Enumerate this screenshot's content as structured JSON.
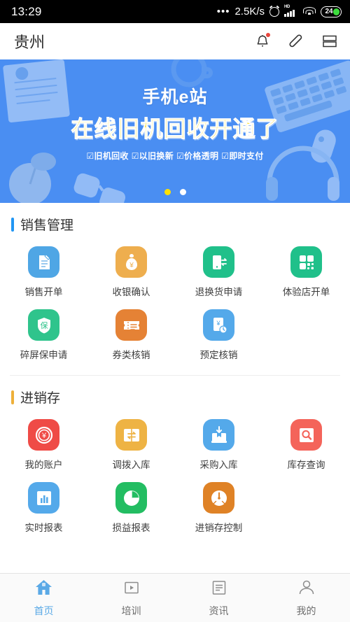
{
  "status_bar": {
    "time": "13:29",
    "dots_icon": "more-dots-icon",
    "net_speed": "2.5K/s",
    "alarm_icon": "alarm-clock-icon",
    "signal_label": "HD",
    "signal_icon": "cellular-signal-icon",
    "wifi_icon": "wifi-icon",
    "battery_level": "24"
  },
  "header": {
    "title": "贵州",
    "notification_icon": "bell-icon",
    "has_notification_badge": true,
    "phone_icon": "phone-handset-icon",
    "layout_icon": "stacked-panels-icon"
  },
  "banner": {
    "brand": "手机e站",
    "headline": "在线旧机回收开通了",
    "features": [
      "旧机回收",
      "以旧换新",
      "价格透明",
      "即时支付"
    ],
    "checkbox_glyph": "☑",
    "bg_color": "#4a8ef2",
    "headline_color": "#ffe033",
    "pages": 2,
    "active_page": 1,
    "active_dot_color": "#ffe100"
  },
  "sections": [
    {
      "title": "销售管理",
      "accent_color": "#2196f3",
      "items": [
        {
          "label": "销售开单",
          "icon": "document-edit-icon",
          "color": "#4fa6e5"
        },
        {
          "label": "收银确认",
          "icon": "money-bag-icon",
          "color": "#eeae4e"
        },
        {
          "label": "退换货申请",
          "icon": "phone-exchange-icon",
          "color": "#20c08a"
        },
        {
          "label": "体验店开单",
          "icon": "qr-code-icon",
          "color": "#20c08a"
        },
        {
          "label": "碎屏保申请",
          "icon": "shield-insurance-icon",
          "color": "#2fc48c"
        },
        {
          "label": "券类核销",
          "icon": "coupon-ticket-icon",
          "color": "#e58235"
        },
        {
          "label": "预定核销",
          "icon": "yuan-card-clock-icon",
          "color": "#54a9ea"
        }
      ]
    },
    {
      "title": "进销存",
      "accent_color": "#eeb03a",
      "items": [
        {
          "label": "我的账户",
          "icon": "yuan-coin-icon",
          "color": "#ef4b46"
        },
        {
          "label": "调拨入库",
          "icon": "transfer-book-icon",
          "color": "#eeb344"
        },
        {
          "label": "采购入库",
          "icon": "box-inbound-icon",
          "color": "#54a9ea"
        },
        {
          "label": "库存查询",
          "icon": "search-box-icon",
          "color": "#f4645a"
        },
        {
          "label": "实时报表",
          "icon": "bar-chart-icon",
          "color": "#54a9ea"
        },
        {
          "label": "损益报表",
          "icon": "pie-chart-icon",
          "color": "#23bd62"
        },
        {
          "label": "进销存控制",
          "icon": "gauge-dial-icon",
          "color": "#df8226"
        }
      ]
    }
  ],
  "tabbar": {
    "active_color": "#5aa9e6",
    "items": [
      {
        "label": "首页",
        "icon": "home-icon",
        "active": true
      },
      {
        "label": "培训",
        "icon": "play-box-icon",
        "active": false
      },
      {
        "label": "资讯",
        "icon": "news-list-icon",
        "active": false
      },
      {
        "label": "我的",
        "icon": "person-icon",
        "active": false
      }
    ]
  }
}
